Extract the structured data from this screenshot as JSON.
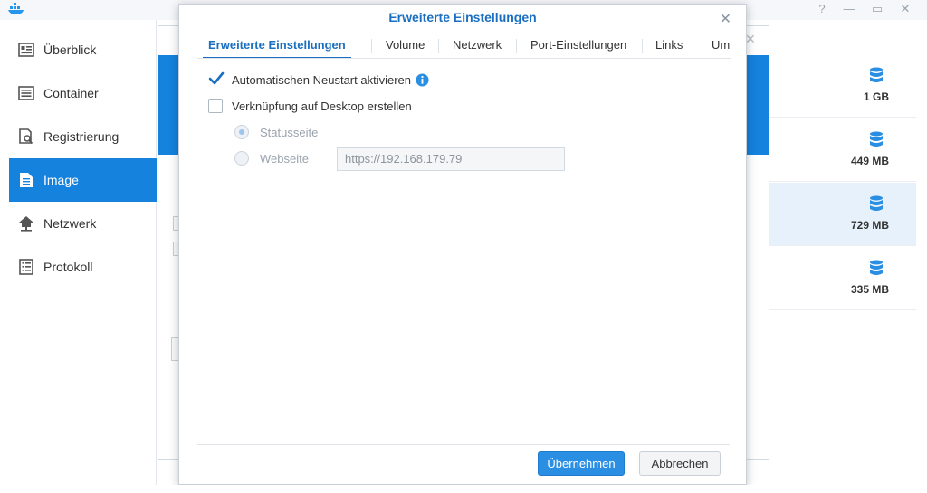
{
  "sidebar": {
    "items": [
      {
        "label": "Überblick",
        "icon": "overview-icon"
      },
      {
        "label": "Container",
        "icon": "container-icon"
      },
      {
        "label": "Registrierung",
        "icon": "registry-icon"
      },
      {
        "label": "Image",
        "icon": "image-icon"
      },
      {
        "label": "Netzwerk",
        "icon": "network-icon"
      },
      {
        "label": "Protokoll",
        "icon": "log-icon"
      }
    ],
    "active_index": 3
  },
  "window_controls": [
    "?",
    "—",
    "▭",
    "✕"
  ],
  "image_list": {
    "items": [
      {
        "size": "1 GB"
      },
      {
        "size": "449 MB"
      },
      {
        "size": "729 MB"
      },
      {
        "size": "335 MB"
      }
    ],
    "selected_index": 2
  },
  "dialog": {
    "title": "Erweiterte Einstellungen",
    "close": "✕",
    "tabs": [
      "Erweiterte Einstellungen",
      "Volume",
      "Netzwerk",
      "Port-Einstellungen",
      "Links",
      "Um"
    ],
    "active_tab": 0,
    "options": {
      "auto_restart": {
        "label": "Automatischen Neustart aktivieren",
        "checked": true
      },
      "desktop_shortcut": {
        "label": "Verknüpfung auf Desktop erstellen",
        "checked": false
      },
      "status_page": {
        "label": "Statusseite",
        "selected": true
      },
      "website": {
        "label": "Webseite",
        "selected": false
      },
      "url_value": "https://192.168.179.79"
    },
    "buttons": {
      "apply": "Übernehmen",
      "cancel": "Abbrechen"
    }
  },
  "colors": {
    "accent": "#1582dd",
    "title": "#1a6fc0",
    "selected_row": "#e6f1fb"
  }
}
